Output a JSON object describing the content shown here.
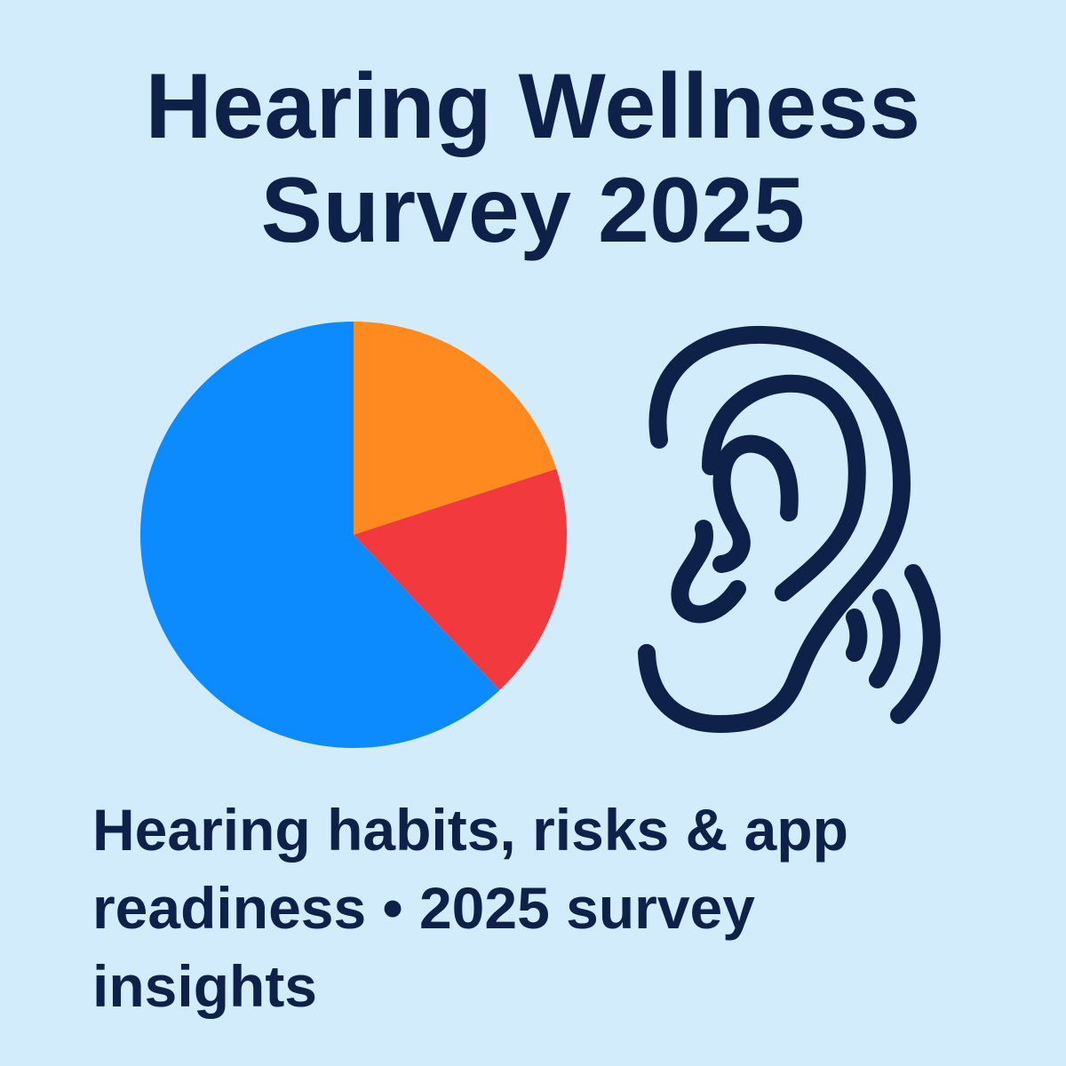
{
  "header": {
    "title_line1": "Hearing Wellness",
    "title_line2": "Survey 2025"
  },
  "chart_data": {
    "type": "pie",
    "title": "",
    "slices": [
      {
        "label": "",
        "value": 20,
        "color": "#ff8a1f"
      },
      {
        "label": "",
        "value": 18,
        "color": "#f23a3e"
      },
      {
        "label": "",
        "value": 62,
        "color": "#0c8bff"
      }
    ],
    "start_angle": "12 o'clock",
    "direction": "clockwise",
    "legend": "none"
  },
  "illustration": {
    "icon": "ear-with-sound-waves-icon",
    "stroke_color": "#0e2148"
  },
  "footer": {
    "tagline_line1": "Hearing habits, risks & app",
    "tagline_line2": "readiness • 2025 survey",
    "tagline_line3": "insights"
  },
  "colors": {
    "background": "#d3ecfb",
    "text": "#0e2148"
  }
}
